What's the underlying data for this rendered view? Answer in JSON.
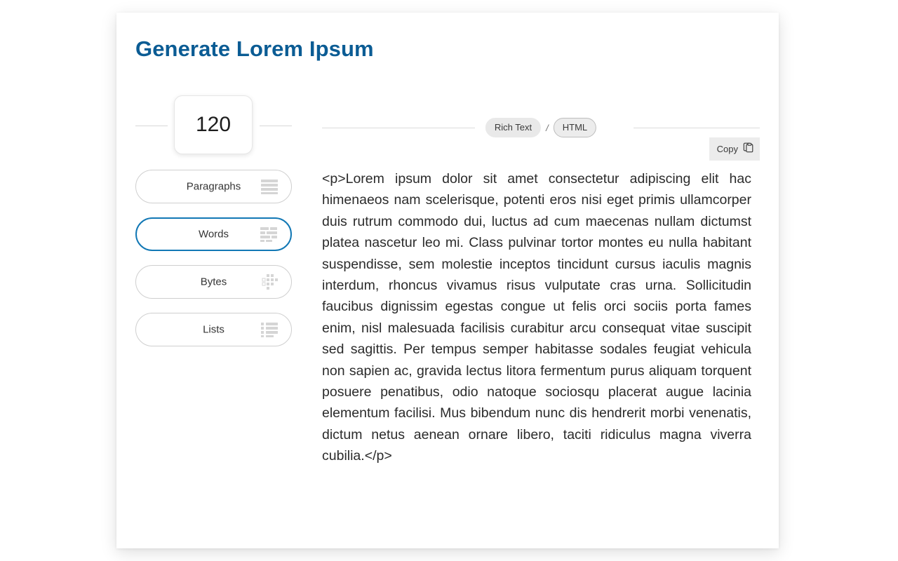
{
  "page": {
    "title": "Generate Lorem Ipsum"
  },
  "amount": {
    "value": "120",
    "placeholder": "120"
  },
  "units": [
    {
      "label": "Paragraphs",
      "icon": "paragraph-lines-icon",
      "selected": false
    },
    {
      "label": "Words",
      "icon": "word-blocks-icon",
      "selected": true
    },
    {
      "label": "Bytes",
      "icon": "byte-dots-icon",
      "selected": false
    },
    {
      "label": "Lists",
      "icon": "list-bullets-icon",
      "selected": false
    }
  ],
  "format": {
    "rich_text_label": "Rich Text",
    "separator": "/",
    "html_label": "HTML",
    "selected": "HTML"
  },
  "copy": {
    "label": "Copy",
    "icon": "clipboard-icon"
  },
  "output": {
    "text": "<p>Lorem ipsum dolor sit amet consectetur adipiscing elit hac himenaeos nam scelerisque, potenti eros nisi eget primis ullamcorper duis rutrum commodo dui, luctus ad cum maecenas nullam dictumst platea nascetur leo mi. Class pulvinar tortor montes eu nulla habitant suspendisse, sem molestie inceptos tincidunt cursus iaculis magnis interdum, rhoncus vivamus risus vulputate cras urna. Sollicitudin faucibus dignissim egestas congue ut felis orci sociis porta fames enim, nisl malesuada facilisis curabitur arcu consequat vitae suscipit sed sagittis. Per tempus semper habitasse sodales feugiat vehicula non sapien ac, gravida lectus litora fermentum purus aliquam torquent posuere penatibus, odio natoque sociosqu placerat augue lacinia elementum facilisi. Mus bibendum nunc dis hendrerit morbi venenatis, dictum netus aenean ornare libero, taciti ridiculus magna viverra cubilia.</p>"
  },
  "colors": {
    "title_blue": "#0b5c94",
    "accent_blue": "#1278b5",
    "icon_gray": "#d5d5d5",
    "pill_gray": "#e9e9e9"
  }
}
